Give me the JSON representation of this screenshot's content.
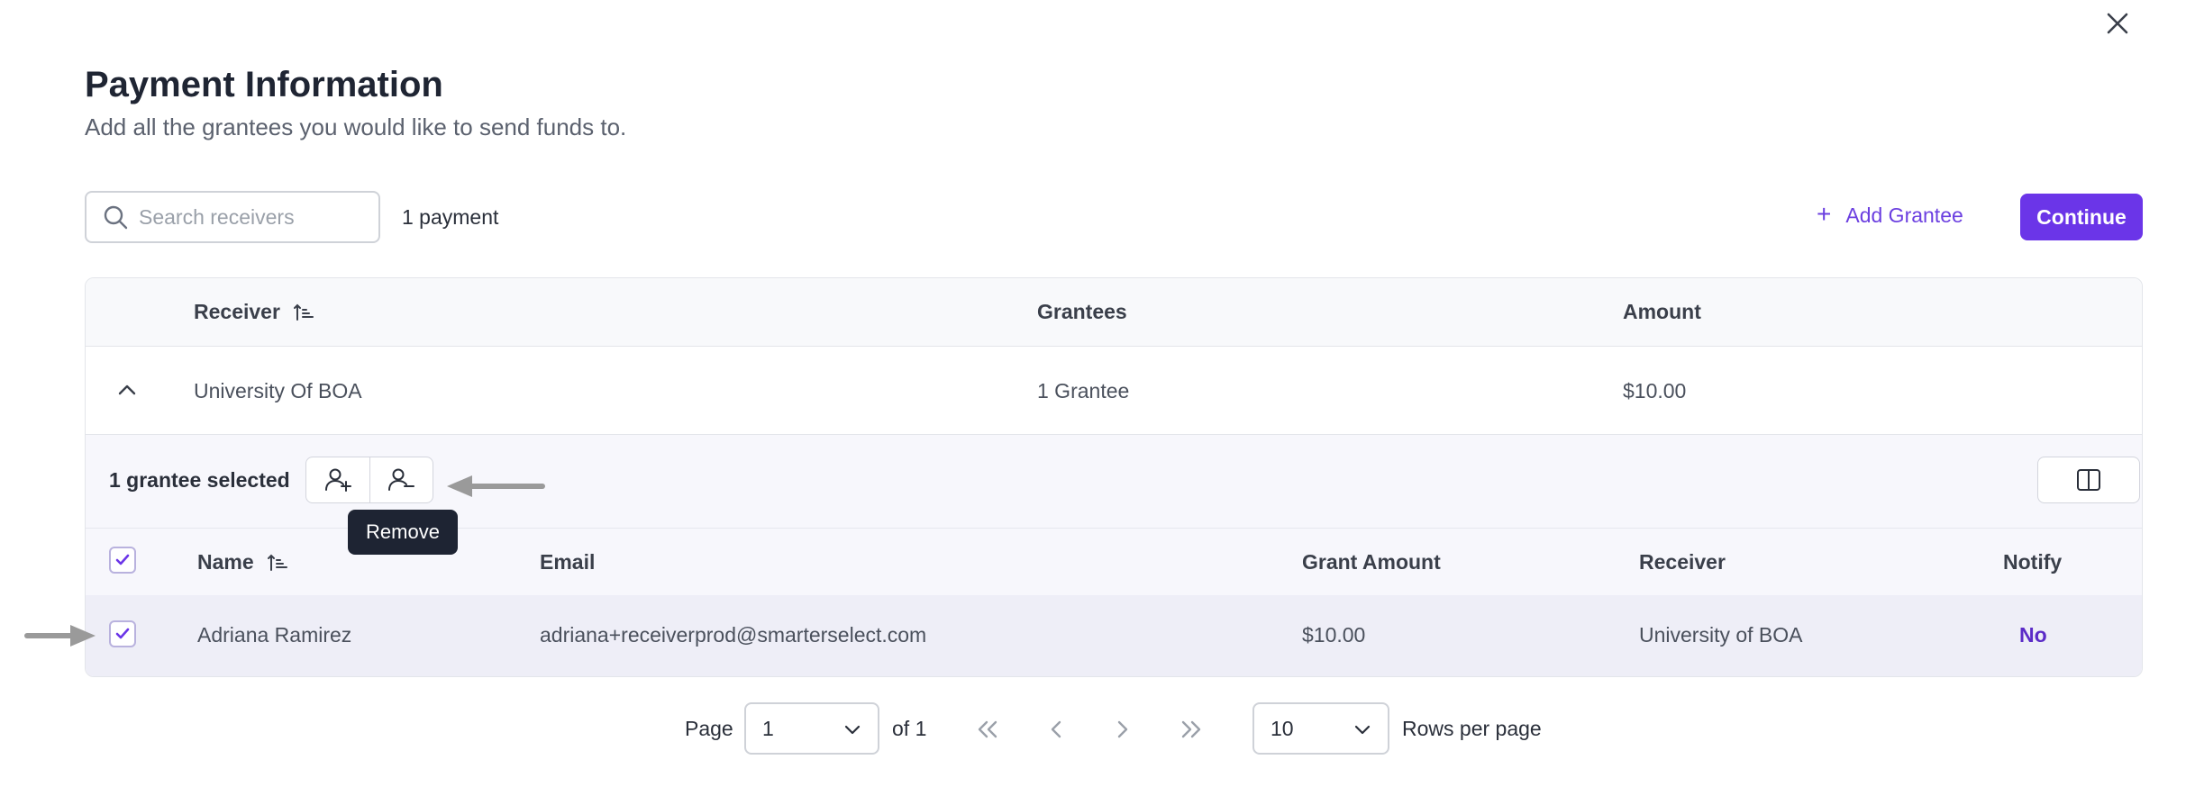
{
  "dialog": {
    "title": "Payment Information",
    "subtitle": "Add all the grantees you would like to send funds to."
  },
  "toolbar": {
    "search_placeholder": "Search receivers",
    "payment_count": "1 payment",
    "add_grantee_label": "Add Grantee",
    "continue_label": "Continue"
  },
  "outer_table": {
    "columns": [
      "Receiver",
      "Grantees",
      "Amount"
    ],
    "rows": [
      {
        "receiver": "University Of BOA",
        "grantees": "1 Grantee",
        "amount": "$10.00"
      }
    ]
  },
  "inner_toolbar": {
    "selected_text": "1 grantee selected",
    "tooltip": "Remove"
  },
  "inner_table": {
    "columns": [
      "Name",
      "Email",
      "Grant Amount",
      "Receiver",
      "Notify"
    ],
    "rows": [
      {
        "name": "Adriana Ramirez",
        "email": "adriana+receiverprod@smarterselect.com",
        "grant_amount": "$10.00",
        "receiver": "University of BOA",
        "notify": "No",
        "selected": true
      }
    ]
  },
  "pagination": {
    "page_label": "Page",
    "current_page": "1",
    "of_label": "of 1",
    "rows_per_page_value": "10",
    "rows_per_page_label": "Rows per page"
  },
  "colors": {
    "accent": "#6b35e8",
    "tooltip_bg": "#1e2433",
    "annotation_arrow": "#9a9a9a"
  }
}
